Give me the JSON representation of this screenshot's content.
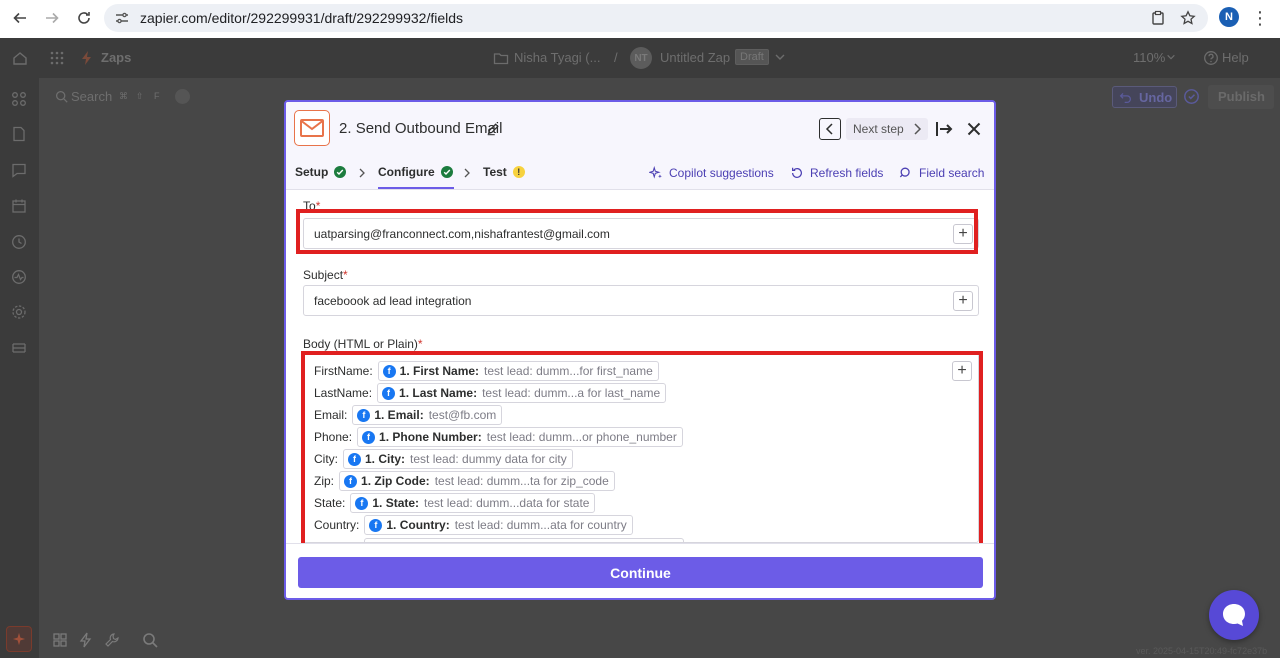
{
  "browser": {
    "url": "zapier.com/editor/292299931/draft/292299932/fields",
    "profile_initial": "N"
  },
  "app": {
    "section_label": "Zaps",
    "owner": "Nisha Tyagi (...",
    "owner_initials": "NT",
    "zap_name": "Untitled Zap",
    "status_badge": "Draft",
    "zoom": "110%",
    "help_label": "Help",
    "search_label": "Search",
    "search_shortcut": [
      "⌘",
      "⇧",
      "F"
    ],
    "undo_label": "Undo",
    "publish_label": "Publish",
    "version_text": "ver. 2025-04-15T20:49-fc72e37b"
  },
  "modal": {
    "step_number": "2.",
    "step_title": "Send Outbound Email",
    "next_step_label": "Next step",
    "tabs": [
      {
        "label": "Setup",
        "status": "complete"
      },
      {
        "label": "Configure",
        "status": "complete"
      },
      {
        "label": "Test",
        "status": "warning"
      }
    ],
    "links": {
      "copilot": "Copilot suggestions",
      "refresh": "Refresh fields",
      "field_search": "Field search"
    },
    "fields": {
      "to": {
        "label": "To",
        "required_mark": "*",
        "value": "uatparsing@franconnect.com,nishafrantest@gmail.com"
      },
      "subject": {
        "label": "Subject",
        "required_mark": "*",
        "value": "faceboook ad lead integration"
      },
      "body": {
        "label": "Body (HTML or Plain)",
        "required_mark": "*",
        "rows": [
          {
            "label": "FirstName:",
            "key": "1. First Name:",
            "value": "test lead: dumm...for first_name"
          },
          {
            "label": "LastName:",
            "key": "1. Last Name:",
            "value": "test lead: dumm...a for last_name"
          },
          {
            "label": "Email:",
            "key": "1. Email:",
            "value": "test@fb.com"
          },
          {
            "label": "Phone:",
            "key": "1. Phone Number:",
            "value": "test lead: dumm...or phone_number"
          },
          {
            "label": "City:",
            "key": "1. City:",
            "value": "test lead: dummy data for city"
          },
          {
            "label": "Zip:",
            "key": "1. Zip Code:",
            "value": "test lead: dumm...ta for zip_code"
          },
          {
            "label": "State:",
            "key": "1. State:",
            "value": "test lead: dumm...data for state"
          },
          {
            "label": "Country:",
            "key": "1. Country:",
            "value": "test lead: dumm...ata for country"
          }
        ]
      }
    },
    "continue_label": "Continue"
  },
  "colors": {
    "accent": "#6c5ce7",
    "highlight": "#e02020",
    "facebook": "#1877f2",
    "success": "#1c7c3e",
    "warning": "#f7d23e"
  }
}
